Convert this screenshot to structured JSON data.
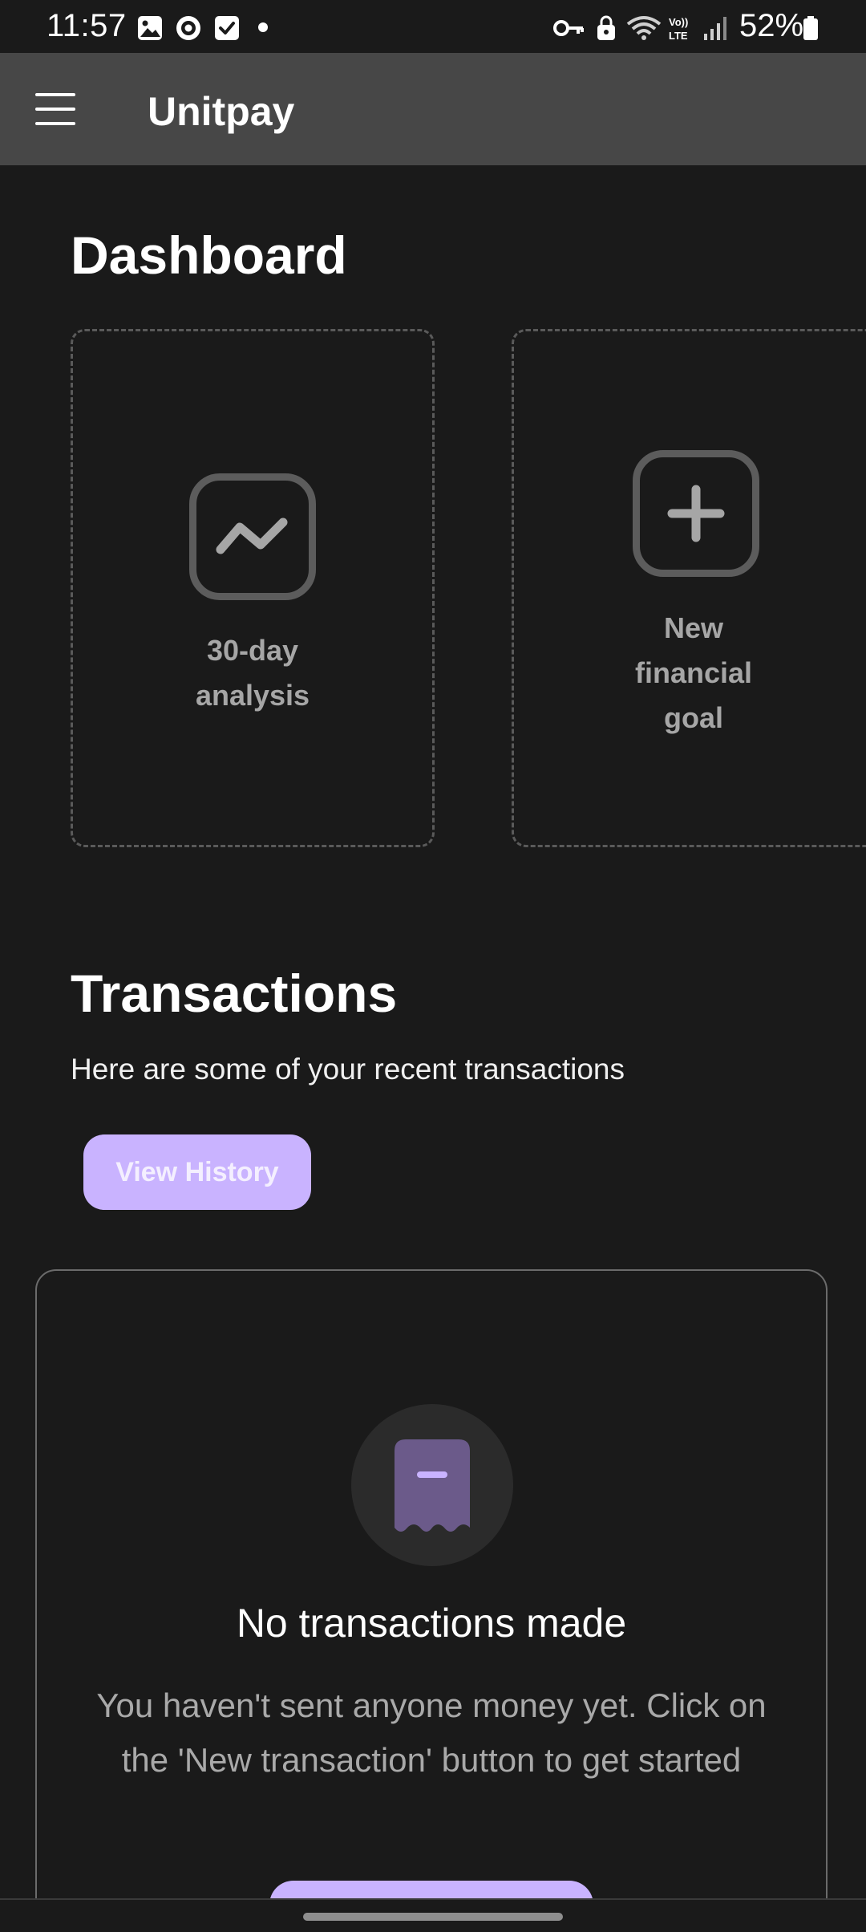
{
  "status_bar": {
    "time": "11:57",
    "battery_percent": "52%",
    "icons": [
      "gallery-icon",
      "vpn-badge-icon",
      "checkbox-icon",
      "notification-dot",
      "key-icon",
      "lock-icon",
      "wifi-icon",
      "volte-icon",
      "signal-icon",
      "battery-icon"
    ]
  },
  "app_bar": {
    "title": "Unitpay",
    "menu_icon": "menu-icon"
  },
  "dashboard": {
    "title": "Dashboard",
    "cards": [
      {
        "label_lines": [
          "30-day",
          "analysis"
        ],
        "icon": "trend-icon"
      },
      {
        "label_lines": [
          "New",
          "financial",
          "goal"
        ],
        "icon": "plus-icon"
      }
    ]
  },
  "transactions": {
    "title": "Transactions",
    "subtitle": "Here are some of your recent transactions",
    "view_history_label": "View History",
    "empty_state": {
      "icon": "receipt-icon",
      "title": "No transactions made",
      "description": "You haven't sent anyone money yet. Click on the 'New transaction' button to get started"
    }
  },
  "colors": {
    "accent": "#c9b3ff",
    "background": "#1a1a1a",
    "app_bar": "#474747",
    "muted_text": "#a6a6a6"
  }
}
